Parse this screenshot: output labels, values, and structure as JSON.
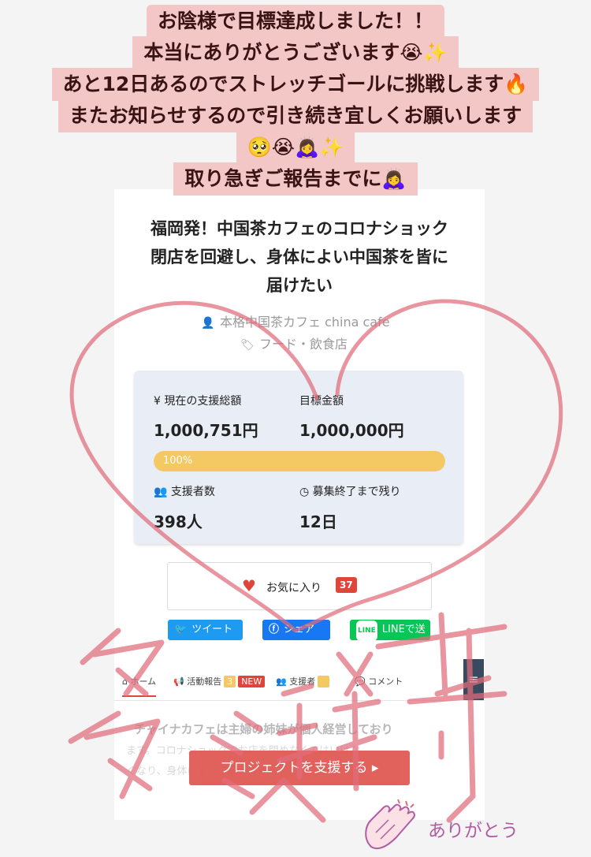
{
  "story": {
    "lines": [
      "お陰様で目標達成しました！！",
      "本当にありがとうございます😭✨",
      "あと12日あるのでストレッチゴールに挑戦します🔥",
      "またお知らせするので引き続き宜しくお願いします",
      "🥺😭🙇‍♀️✨",
      "取り急ぎご報告までに🙇‍♀️"
    ],
    "handwritten": "多謝",
    "sticker_text": "ありがとう"
  },
  "project": {
    "title_lines": [
      "福岡発！中国茶カフェのコロナショック",
      "閉店を回避し、身体によい中国茶を皆に",
      "届けたい"
    ],
    "owner": "本格中国茶カフェ china cafe",
    "category": "フード・飲食店"
  },
  "stats": {
    "current_label": "¥ 現在の支援総額",
    "current_value": "1,000,751円",
    "goal_label": "目標金額",
    "goal_value": "1,000,000円",
    "progress_text": "100%",
    "progress": 1.0,
    "backers_label": "支援者数",
    "backers_value": "398人",
    "remaining_label": "募集終了まで残り",
    "remaining_value": "12日"
  },
  "favorite": {
    "label": "お気に入り",
    "count": "37"
  },
  "share": {
    "twitter": "ツイート",
    "facebook": "シェア",
    "line_icon": "LINE",
    "line": "LINEで送る"
  },
  "tabs": {
    "home": "ホーム",
    "reports": "活動報告",
    "reports_count": "3",
    "reports_new": "NEW",
    "backers": "支援者",
    "comments": "コメント"
  },
  "body": {
    "line1": "チャイナカフェは主婦の姉妹が個人経営しており",
    "line2": "ます。コロナショックでお店を閉めなくてはいけな",
    "line3": "くなり、身体によい中国茶を届けたいと思います"
  },
  "support_button": "プロジェクトを支援する",
  "colors": {
    "accent_red": "#e0453c",
    "progress_yellow": "#f4c862",
    "twitter": "#1d9bf0",
    "facebook": "#1877f2",
    "line": "#06c755",
    "story_bg": "#f2c7c6",
    "stroke_pink": "#e06c7c"
  }
}
